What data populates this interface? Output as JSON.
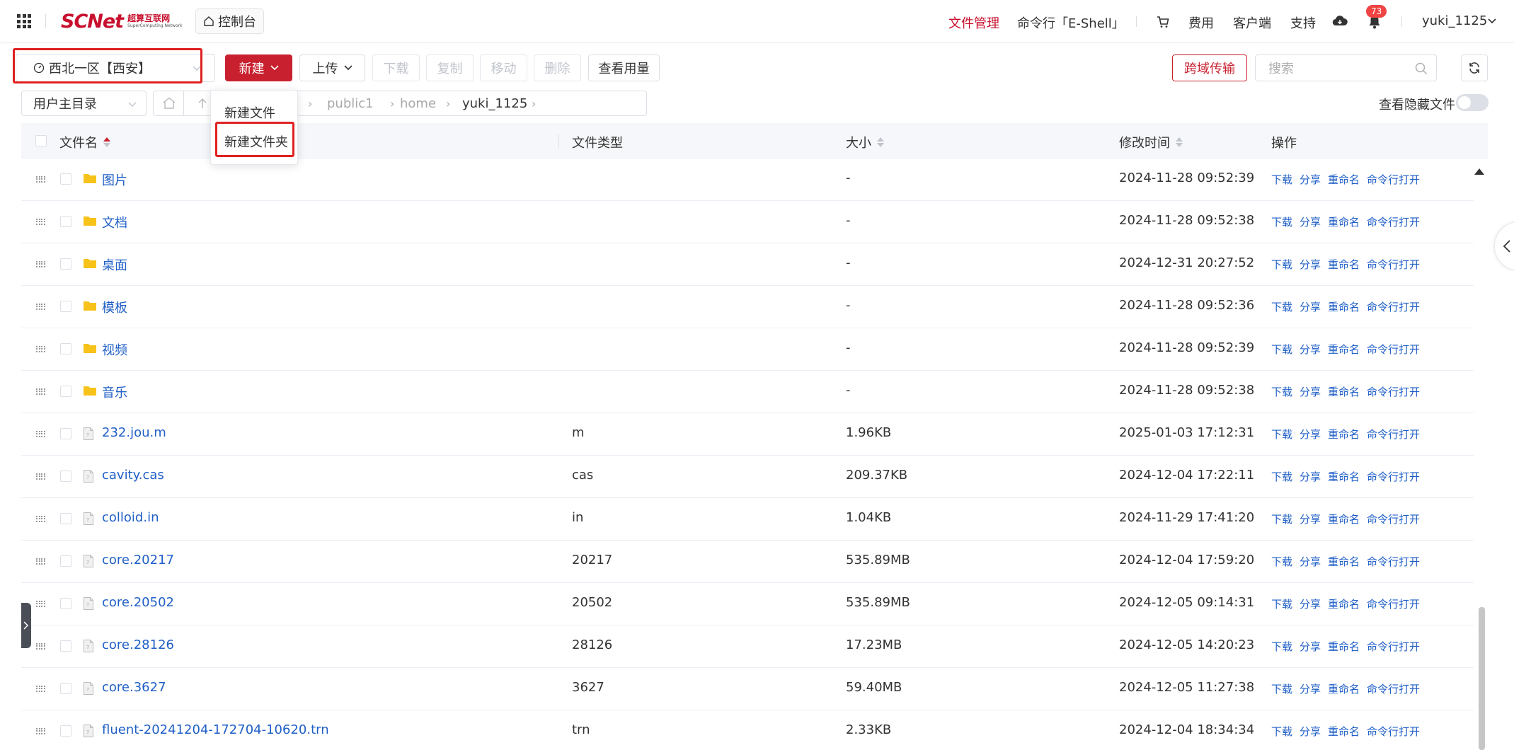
{
  "topnav": {
    "logo_main": "SCNet",
    "logo_cn": "超算互联网",
    "logo_en": "SuperComputing Network",
    "console": "控制台",
    "file_manage": "文件管理",
    "eshell": "命令行「E-Shell」",
    "fees": "费用",
    "client": "客户端",
    "support": "支持",
    "notifications": "73",
    "username": "yuki_1125",
    "accent_color": "#c8102e"
  },
  "toolbar": {
    "region": "西北一区【西安】",
    "new": "新建",
    "upload": "上传",
    "download": "下载",
    "copy": "复制",
    "move": "移动",
    "delete": "删除",
    "usage": "查看用量",
    "cross_transfer": "跨域传输",
    "search_placeholder": "搜索"
  },
  "pathbar": {
    "home_dir": "用户主目录",
    "segments": [
      "public1",
      "home",
      "yuki_1125"
    ],
    "show_hidden": "查看隐藏文件"
  },
  "dropdown": {
    "new_file": "新建文件",
    "new_folder": "新建文件夹"
  },
  "table": {
    "headers": {
      "name": "文件名",
      "type": "文件类型",
      "size": "大小",
      "mtime": "修改时间",
      "ops": "操作"
    },
    "ops": [
      "下载",
      "分享",
      "重命名",
      "命令行打开"
    ],
    "rows": [
      {
        "name": "图片",
        "kind": "folder",
        "type": "",
        "size": "-",
        "mtime": "2024-11-28 09:52:39"
      },
      {
        "name": "文档",
        "kind": "folder",
        "type": "",
        "size": "-",
        "mtime": "2024-11-28 09:52:38"
      },
      {
        "name": "桌面",
        "kind": "folder",
        "type": "",
        "size": "-",
        "mtime": "2024-12-31 20:27:52"
      },
      {
        "name": "模板",
        "kind": "folder",
        "type": "",
        "size": "-",
        "mtime": "2024-11-28 09:52:36"
      },
      {
        "name": "视频",
        "kind": "folder",
        "type": "",
        "size": "-",
        "mtime": "2024-11-28 09:52:39"
      },
      {
        "name": "音乐",
        "kind": "folder",
        "type": "",
        "size": "-",
        "mtime": "2024-11-28 09:52:38"
      },
      {
        "name": "232.jou.m",
        "kind": "file",
        "type": "m",
        "size": "1.96KB",
        "mtime": "2025-01-03 17:12:31"
      },
      {
        "name": "cavity.cas",
        "kind": "file",
        "type": "cas",
        "size": "209.37KB",
        "mtime": "2024-12-04 17:22:11"
      },
      {
        "name": "colloid.in",
        "kind": "file",
        "type": "in",
        "size": "1.04KB",
        "mtime": "2024-11-29 17:41:20"
      },
      {
        "name": "core.20217",
        "kind": "file",
        "type": "20217",
        "size": "535.89MB",
        "mtime": "2024-12-04 17:59:20"
      },
      {
        "name": "core.20502",
        "kind": "file",
        "type": "20502",
        "size": "535.89MB",
        "mtime": "2024-12-05 09:14:31"
      },
      {
        "name": "core.28126",
        "kind": "file",
        "type": "28126",
        "size": "17.23MB",
        "mtime": "2024-12-05 14:20:23"
      },
      {
        "name": "core.3627",
        "kind": "file",
        "type": "3627",
        "size": "59.40MB",
        "mtime": "2024-12-05 11:27:38"
      },
      {
        "name": "fluent-20241204-172704-10620.trn",
        "kind": "file",
        "type": "trn",
        "size": "2.33KB",
        "mtime": "2024-12-04 18:34:34"
      }
    ]
  }
}
